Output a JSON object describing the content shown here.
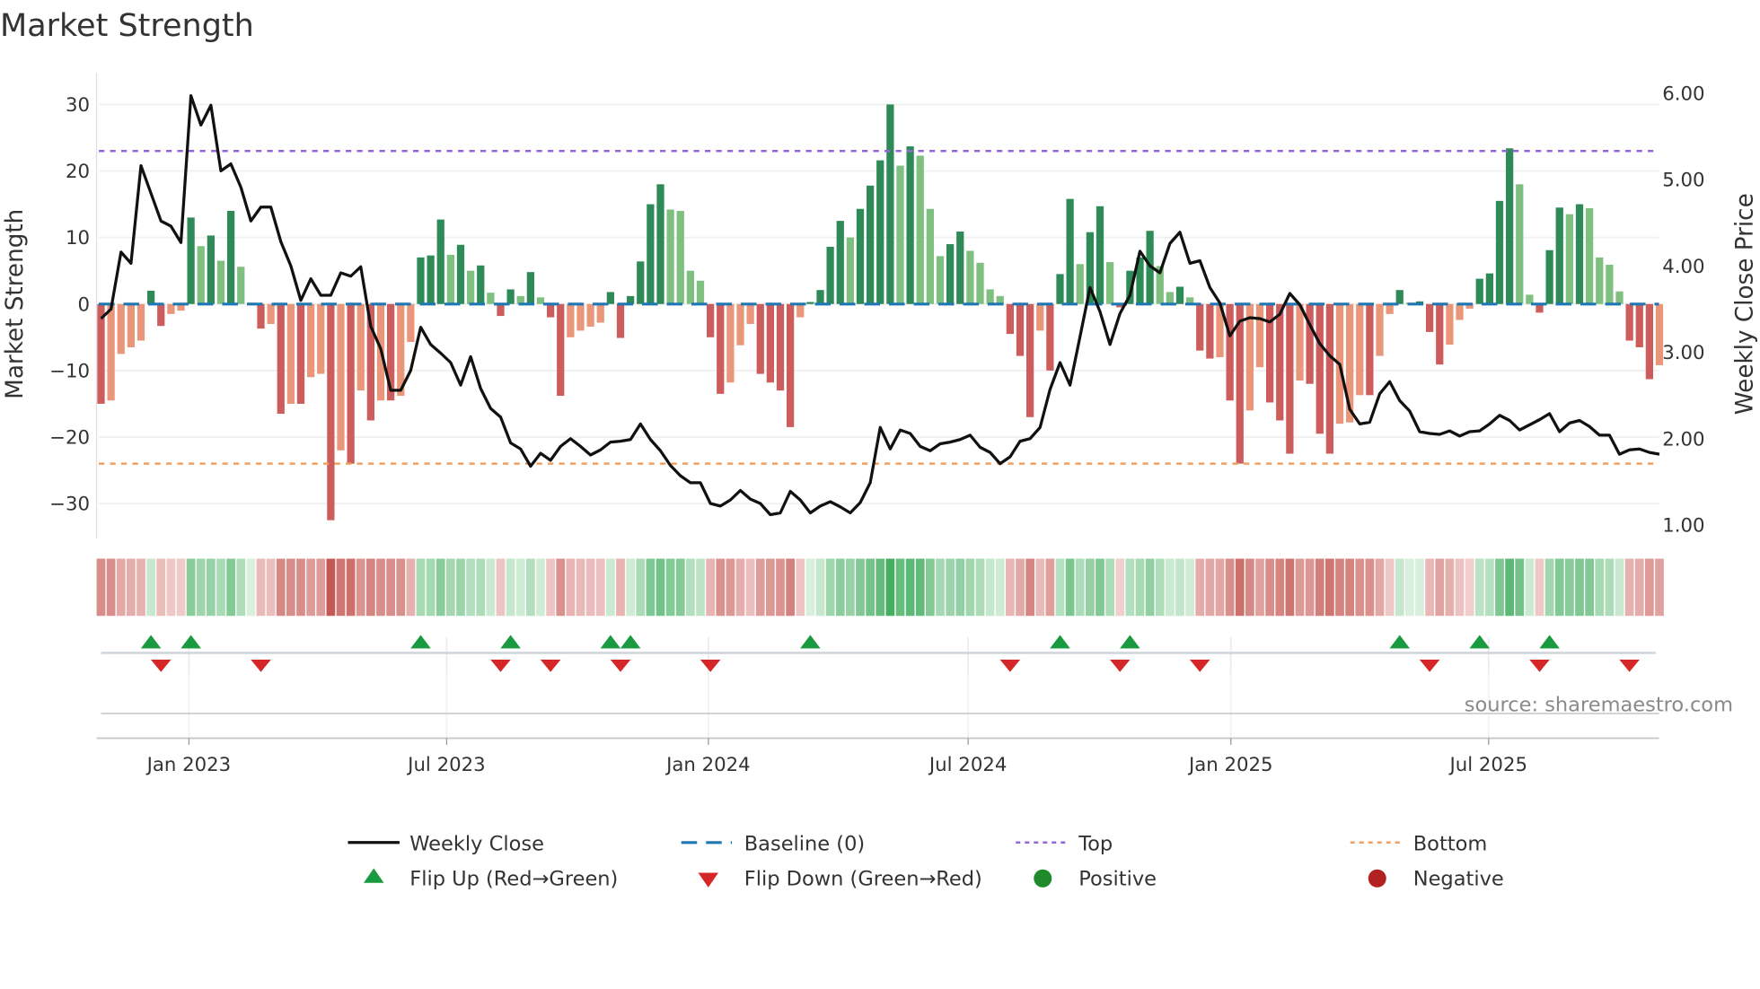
{
  "chart_data": {
    "type": "bar",
    "title": "Market Strength",
    "ylabel": "Market Strength",
    "y2label": "Weekly Close Price",
    "ylim": [
      -35,
      33
    ],
    "y2lim": [
      1.0,
      6.0
    ],
    "yticks": [
      "30",
      "20",
      "10",
      "0",
      "−10",
      "−20",
      "−30"
    ],
    "ytick_values": [
      30,
      20,
      10,
      0,
      -10,
      -20,
      -30
    ],
    "y2ticks": [
      "6.00",
      "5.00",
      "4.00",
      "3.00",
      "2.00",
      "1.00"
    ],
    "y2tick_values": [
      6,
      5,
      4,
      3,
      2,
      1
    ],
    "xticks": [
      {
        "label": "Jan 2023",
        "week": 9.8
      },
      {
        "label": "Jul 2023",
        "week": 35.6
      },
      {
        "label": "Jan 2024",
        "week": 61.8
      },
      {
        "label": "Jul 2024",
        "week": 87.8
      },
      {
        "label": "Jan 2025",
        "week": 114.1
      },
      {
        "label": "Jul 2025",
        "week": 139.9
      }
    ],
    "top": 23,
    "bottom": -24,
    "baseline": 0,
    "strength": [
      -15,
      -14.5,
      -7.5,
      -6.5,
      -5.5,
      2,
      -3.3,
      -1.5,
      -1,
      13,
      8.7,
      10.3,
      6.5,
      14,
      5.6,
      0.2,
      -3.7,
      -3,
      -16.5,
      -15,
      -15,
      -11,
      -10.5,
      -32.5,
      -22,
      -24,
      -13,
      -17.5,
      -14.5,
      -14.5,
      -13.8,
      -5.7,
      7,
      7.3,
      12.7,
      7.4,
      8.9,
      5,
      5.8,
      1.7,
      -1.8,
      2.2,
      1.2,
      4.8,
      1,
      -2,
      -13.8,
      -5,
      -4,
      -3.4,
      -2.8,
      1.8,
      -5.1,
      1.2,
      6.4,
      15,
      18,
      14.2,
      14,
      5,
      3.5,
      -5,
      -13.5,
      -11.8,
      -6.2,
      -3,
      -10.5,
      -11.8,
      -13,
      -18.5,
      -2,
      0.3,
      2.1,
      8.6,
      12.5,
      10,
      14.3,
      17.8,
      21.6,
      30,
      20.8,
      23.7,
      22.3,
      14.3,
      7.2,
      9,
      10.9,
      8,
      6.2,
      2.2,
      1.2,
      -4.5,
      -7.8,
      -17,
      -4,
      -10,
      4.5,
      15.8,
      6,
      10.8,
      14.7,
      6.3,
      -0.5,
      5,
      7,
      11,
      5.7,
      1.8,
      2.6,
      1,
      -7,
      -8.2,
      -8,
      -14.5,
      -24,
      -16,
      -9.5,
      -14.8,
      -17.5,
      -22.5,
      -11.5,
      -12,
      -19.5,
      -22.5,
      -18,
      -17.8,
      -13.7,
      -13.7,
      -7.8,
      -1.5,
      2.1,
      0.2,
      0.4,
      -4.2,
      -9.1,
      -6.1,
      -2.4,
      -0.7,
      3.8,
      4.6,
      15.5,
      23.4,
      18,
      1.4,
      -1.3,
      8.1,
      14.5,
      13.5,
      15,
      14.4,
      7,
      5.9,
      1.9,
      -5.5,
      -6.5,
      -11.3,
      -9.2
    ],
    "weekly_close": [
      3.39,
      3.5,
      4.16,
      4.03,
      5.16,
      4.84,
      4.52,
      4.46,
      4.27,
      5.97,
      5.63,
      5.86,
      5.1,
      5.18,
      4.91,
      4.52,
      4.68,
      4.68,
      4.28,
      4.0,
      3.6,
      3.85,
      3.66,
      3.66,
      3.92,
      3.88,
      3.99,
      3.3,
      3.04,
      2.56,
      2.56,
      2.79,
      3.29,
      3.09,
      2.99,
      2.88,
      2.62,
      2.95,
      2.58,
      2.35,
      2.25,
      1.95,
      1.88,
      1.68,
      1.83,
      1.75,
      1.91,
      2.0,
      1.91,
      1.81,
      1.87,
      1.96,
      1.97,
      1.99,
      2.17,
      1.99,
      1.86,
      1.69,
      1.57,
      1.49,
      1.49,
      1.25,
      1.22,
      1.29,
      1.4,
      1.3,
      1.25,
      1.12,
      1.14,
      1.39,
      1.29,
      1.14,
      1.22,
      1.27,
      1.21,
      1.14,
      1.26,
      1.49,
      2.13,
      1.88,
      2.1,
      2.06,
      1.91,
      1.86,
      1.94,
      1.96,
      1.99,
      2.04,
      1.9,
      1.84,
      1.71,
      1.79,
      1.97,
      2.0,
      2.13,
      2.57,
      2.88,
      2.62,
      3.18,
      3.75,
      3.47,
      3.09,
      3.45,
      3.66,
      4.17,
      4.0,
      3.92,
      4.26,
      4.39,
      4.03,
      4.06,
      3.75,
      3.57,
      3.19,
      3.36,
      3.4,
      3.39,
      3.35,
      3.44,
      3.68,
      3.55,
      3.32,
      3.1,
      2.96,
      2.86,
      2.34,
      2.17,
      2.19,
      2.52,
      2.66,
      2.44,
      2.32,
      2.08,
      2.06,
      2.05,
      2.09,
      2.03,
      2.08,
      2.09,
      2.17,
      2.27,
      2.21,
      2.1,
      2.16,
      2.22,
      2.29,
      2.08,
      2.18,
      2.21,
      2.14,
      2.04,
      2.04,
      1.82,
      1.87,
      1.88,
      1.84,
      1.82
    ],
    "legend": {
      "placement": "bottom",
      "items": [
        "Weekly Close",
        "Baseline (0)",
        "Top",
        "Bottom",
        "Flip Up (Red→Green)",
        "Flip Down (Green→Red)",
        "Positive",
        "Negative"
      ]
    },
    "grid": true,
    "source": "source: sharemaestro.com"
  },
  "colors": {
    "up_strong": "#2e8b57",
    "up_weak": "#7fbf7f",
    "down_strong": "#cd5c5c",
    "down_weak": "#e9967a",
    "close": "#111111",
    "baseline": "#1f77b4",
    "top": "#9467d8",
    "bottom": "#f0a060",
    "flip_up": "#1a9a40",
    "flip_down": "#d62728",
    "positive": "#1e8a2a",
    "negative": "#b22222"
  }
}
